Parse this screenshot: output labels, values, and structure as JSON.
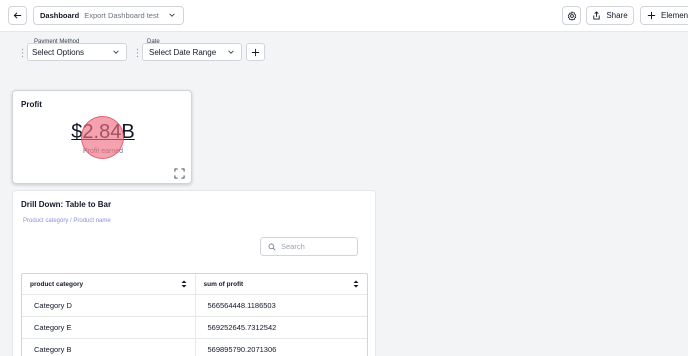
{
  "header": {
    "dashboard_label": "Dashboard",
    "dashboard_name": "Export Dashboard test",
    "share_label": "Share",
    "element_label": "Element"
  },
  "filters": [
    {
      "label": "Payment Method",
      "value": "Select Options"
    },
    {
      "label": "Date",
      "value": "Select Date Range"
    }
  ],
  "profit_card": {
    "title": "Profit",
    "value": "$2.84B",
    "subtitle": "Profit earned"
  },
  "drill_card": {
    "title": "Drill Down: Table to Bar",
    "breadcrumb": "Product category / Product name",
    "search_placeholder": "Search",
    "columns": [
      "product category",
      "sum of profit"
    ],
    "rows": [
      [
        "Category D",
        "566564448.1186503"
      ],
      [
        "Category E",
        "569252645.7312542"
      ],
      [
        "Category B",
        "569895790.2071306"
      ]
    ]
  },
  "colors": {
    "accent_link": "#8b8fd6",
    "click_marker": "#f06e82",
    "background": "#f3f4f6"
  }
}
